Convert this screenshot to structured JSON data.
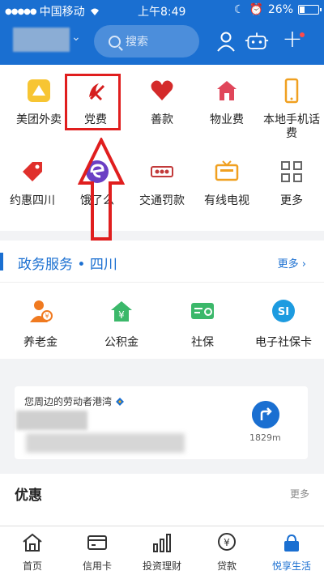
{
  "status": {
    "carrier": "中国移动",
    "time": "上午8:49",
    "battery_text": "26%",
    "battery_level": 0.26
  },
  "header": {
    "search_placeholder": "搜索"
  },
  "services": [
    {
      "label": "美团外卖",
      "icon": "meituan-icon"
    },
    {
      "label": "党费",
      "icon": "party-emblem-icon"
    },
    {
      "label": "善款",
      "icon": "heart-icon"
    },
    {
      "label": "物业费",
      "icon": "house-icon"
    },
    {
      "label": "本地手机话费",
      "icon": "phone-icon"
    },
    {
      "label": "约惠四川",
      "icon": "tag-icon"
    },
    {
      "label": "饿了么",
      "icon": "eleme-icon"
    },
    {
      "label": "交通罚款",
      "icon": "traffic-icon"
    },
    {
      "label": "有线电视",
      "icon": "tv-icon"
    },
    {
      "label": "更多",
      "icon": "grid-icon"
    }
  ],
  "gov": {
    "title": "政务服务 • 四川",
    "more": "更多",
    "items": [
      {
        "label": "养老金",
        "icon": "pension-icon"
      },
      {
        "label": "公积金",
        "icon": "fund-icon"
      },
      {
        "label": "社保",
        "icon": "social-security-icon"
      },
      {
        "label": "电子社保卡",
        "icon": "e-card-icon"
      }
    ]
  },
  "nearby": {
    "title": "您周边的劳动者港湾",
    "distance": "1829m"
  },
  "promo": {
    "title": "优惠",
    "more": "更多"
  },
  "tabs": [
    {
      "label": "首页",
      "icon": "home-icon"
    },
    {
      "label": "信用卡",
      "icon": "credit-card-icon"
    },
    {
      "label": "投资理财",
      "icon": "bar-chart-icon"
    },
    {
      "label": "贷款",
      "icon": "loan-icon"
    },
    {
      "label": "悦享生活",
      "icon": "life-icon",
      "active": true
    }
  ],
  "colors": {
    "brand_blue": "#1a6fd1",
    "highlight_red": "#e01e1e"
  }
}
